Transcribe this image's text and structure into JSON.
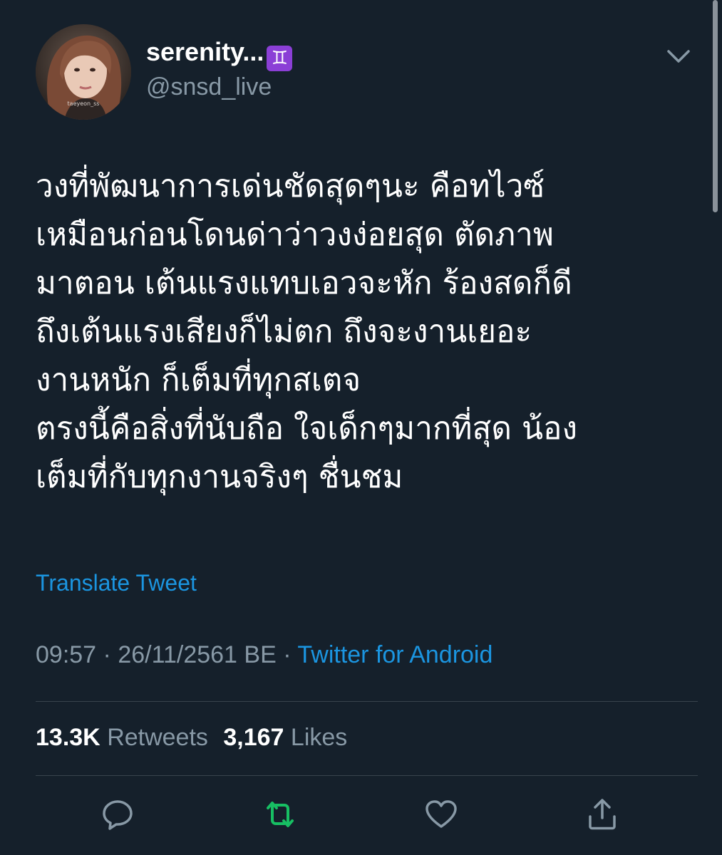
{
  "tweet": {
    "display_name": "serenity...",
    "name_badge": "♊",
    "handle": "@snsd_live",
    "avatar_watermark": "taeyeon_ss",
    "text_lines": [
      "วงที่พัฒนาการเด่นชัดสุดๆนะ คือทไวซ์",
      "เหมือนก่อนโดนด่าว่าวงง่อยสุด ตัดภาพ",
      "มาตอน เต้นแรงแทบเอวจะหัก ร้องสดก็ดี",
      "ถึงเต้นแรงเสียงก็ไม่ตก ถึงจะงานเยอะ",
      "งานหนัก ก็เต็มที่ทุกสเตจ",
      "ตรงนี้คือสิ่งที่นับถือ ใจเด็กๆมากที่สุด น้อง",
      "เต็มที่กับทุกงานจริงๆ ชื่นชม"
    ],
    "translate_label": "Translate Tweet",
    "time": "09:57",
    "date": "26/11/2561 BE",
    "separator": " · ",
    "source": "Twitter for Android",
    "retweets_count": "13.3K",
    "retweets_label": "Retweets",
    "likes_count": "3,167",
    "likes_label": "Likes"
  },
  "icons": {
    "caret": "chevron-down-icon",
    "reply": "reply-icon",
    "retweet": "retweet-icon",
    "like": "heart-icon",
    "share": "share-icon"
  },
  "colors": {
    "background": "#15202b",
    "text_primary": "#ffffff",
    "text_secondary": "#8899a6",
    "link": "#1b95e0",
    "retweet_active": "#17bf63",
    "divider": "#38444d",
    "badge": "#8b3fd6"
  }
}
